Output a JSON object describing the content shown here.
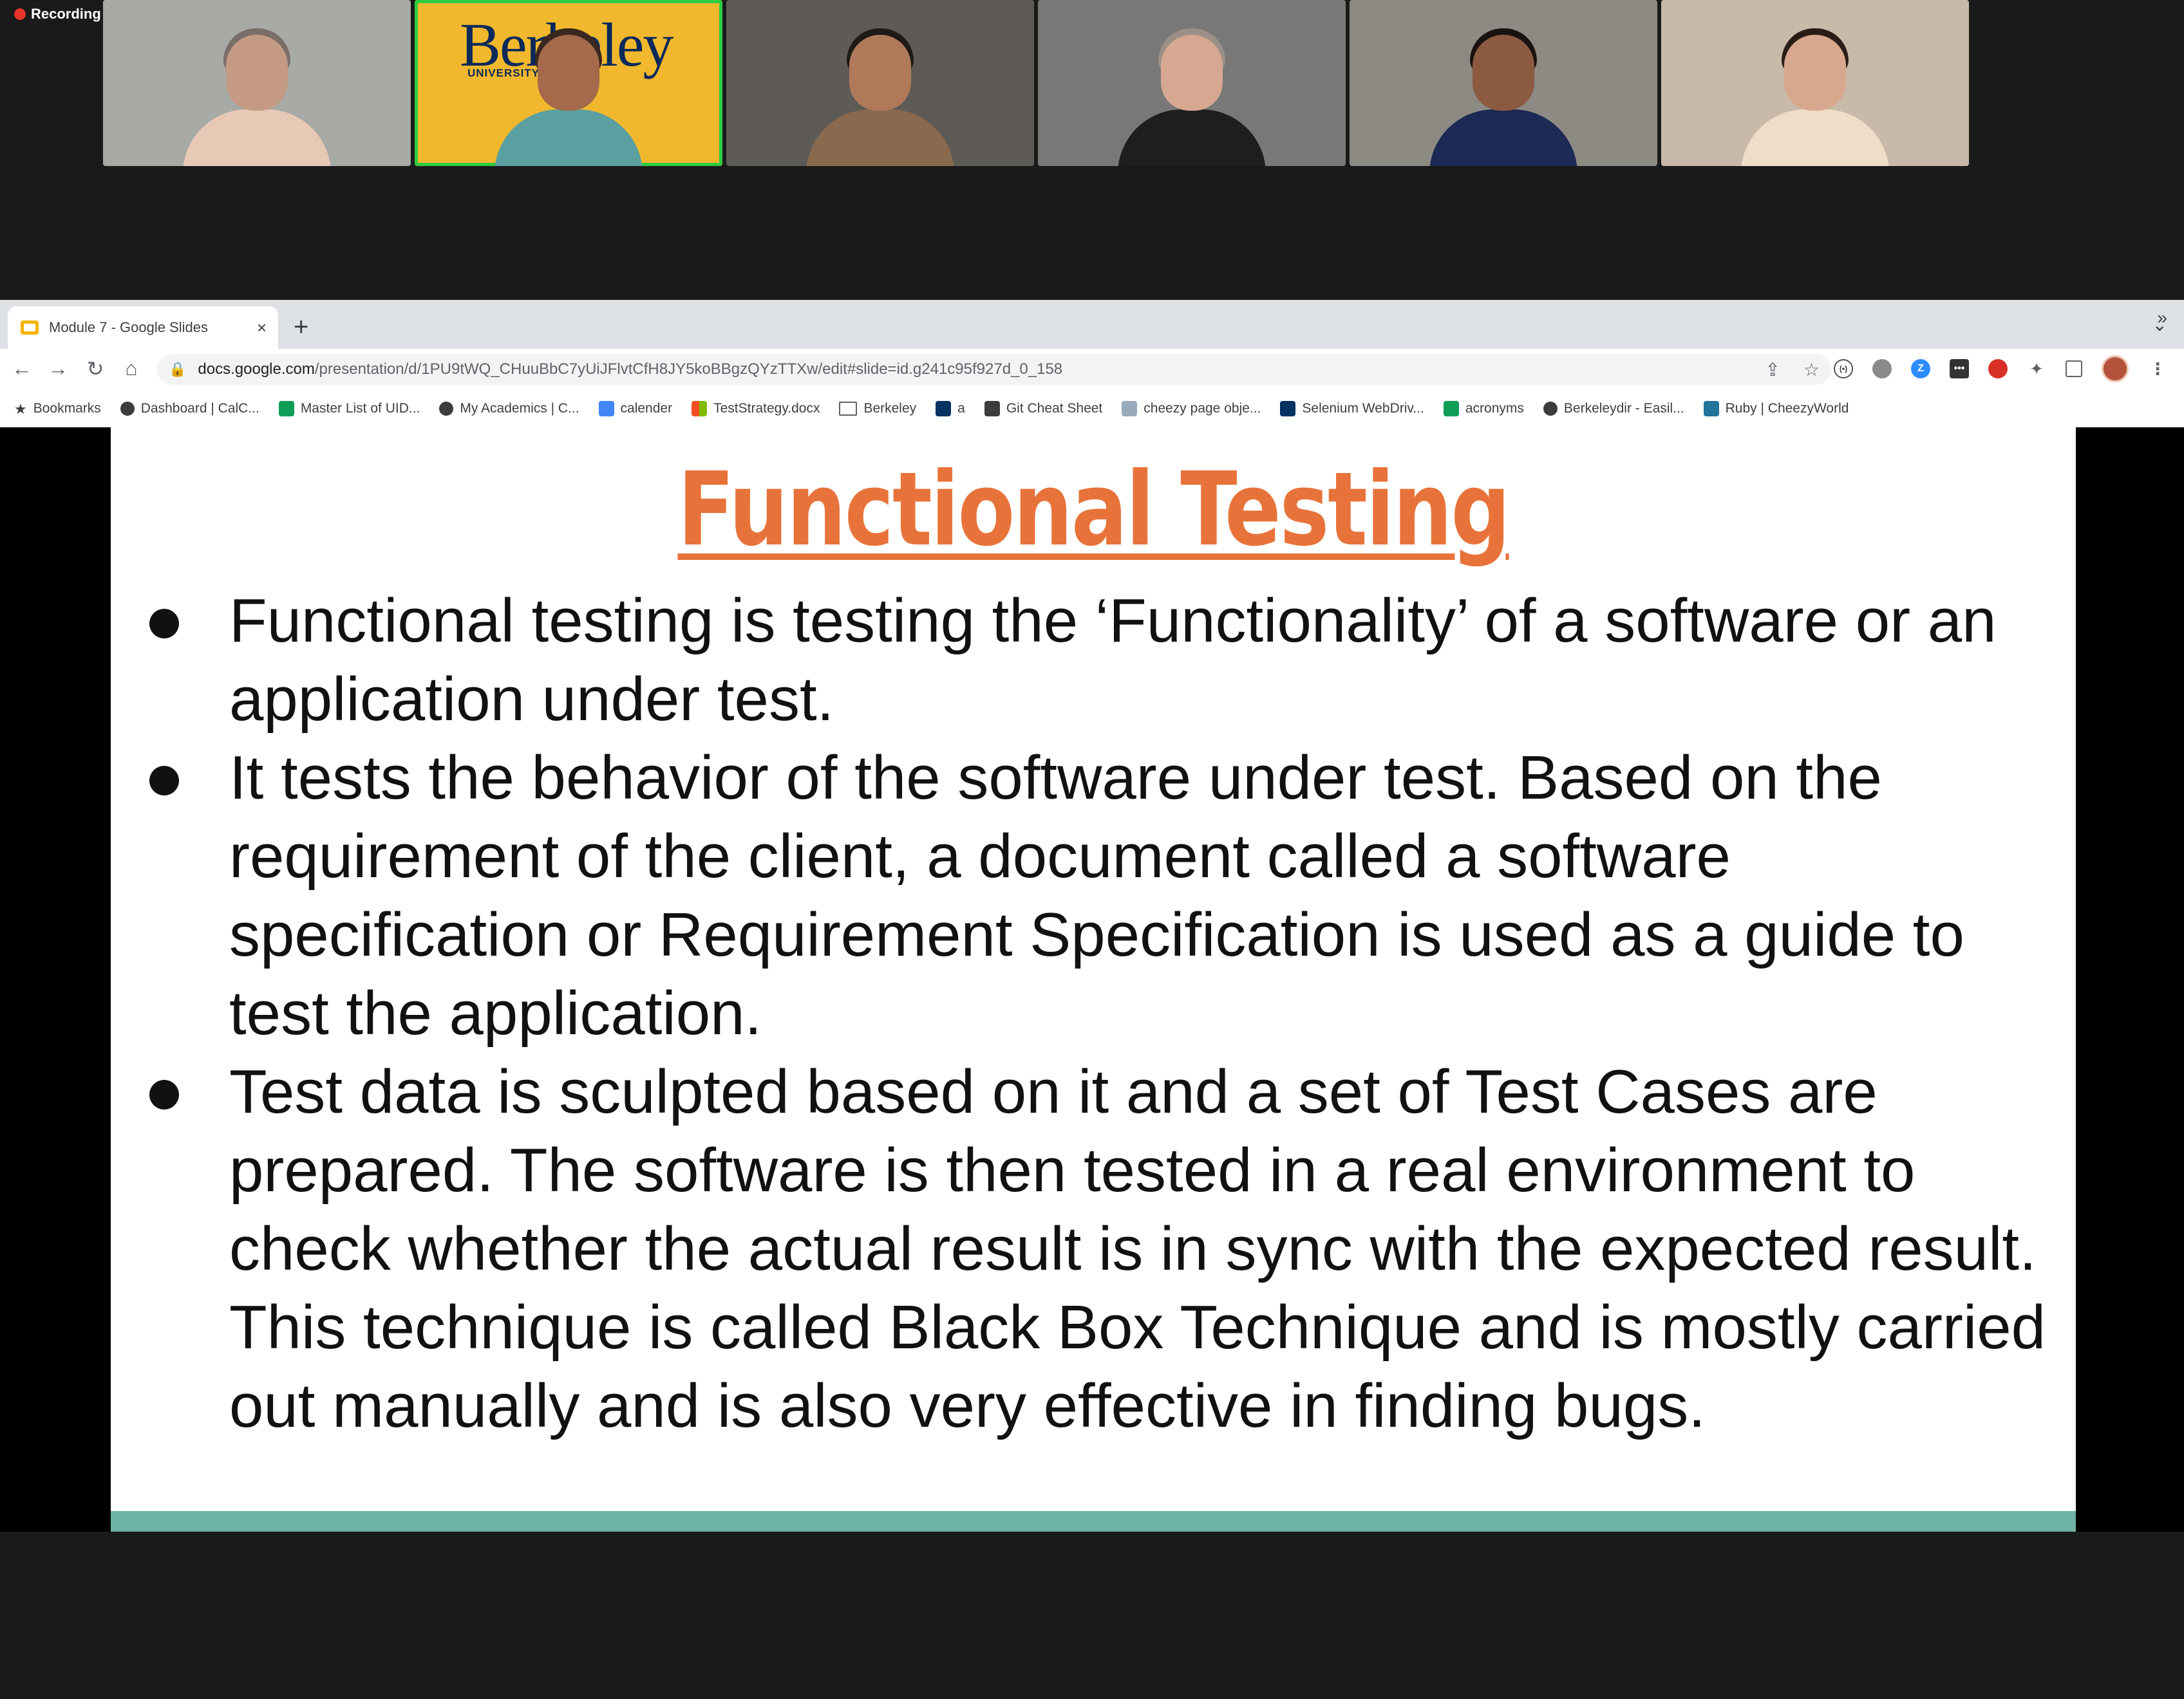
{
  "meeting": {
    "recording_label": "Recording",
    "participants": [
      {
        "bg": "#a7aaa5",
        "skin": "#c49a84",
        "hair": "#7a6e68",
        "shirt": "#e8c9b6"
      },
      {
        "bg": "#f1b82d",
        "skin": "#a5694c",
        "hair": "#3a2720",
        "shirt": "#5aa0a0",
        "logo_text": "Berkeley",
        "logo_sub": "UNIVERSITY OF"
      },
      {
        "bg": "#5e5a55",
        "skin": "#b07a5a",
        "hair": "#1e1a18",
        "shirt": "#8a6a4e"
      },
      {
        "bg": "#7a7876",
        "skin": "#d6a892",
        "hair": "#9a9088",
        "shirt": "#1e1e1e"
      },
      {
        "bg": "#8d8a84",
        "skin": "#8c5a40",
        "hair": "#1a1210",
        "shirt": "#1c2a55"
      },
      {
        "bg": "#c8b9a8",
        "skin": "#d8a88e",
        "hair": "#2a1c16",
        "shirt": "#f0ddc8"
      }
    ]
  },
  "browser": {
    "tab_title": "Module 7 - Google Slides",
    "tab_close": "×",
    "new_tab": "+",
    "tab_search": "⌄",
    "nav": {
      "back": "←",
      "forward": "→",
      "reload": "↻",
      "home": "⌂"
    },
    "url_host": "docs.google.com",
    "url_path": "/presentation/d/1PU9tWQ_CHuuBbC7yUiJFlvtCfH8JY5koBBgzQYzTTXw/edit#slide=id.g241c95f927d_0_158",
    "omnibox_share": "⇪",
    "omnibox_star": "☆",
    "bookmarks": [
      {
        "label": "Bookmarks",
        "icon": "star-icon",
        "color": "#3c4043"
      },
      {
        "label": "Dashboard | CalC...",
        "icon": "c-icon",
        "color": "#3c3c3c"
      },
      {
        "label": "Master List of UID...",
        "icon": "sheets-icon",
        "color": "#0f9d58"
      },
      {
        "label": "My Academics | C...",
        "icon": "c-icon",
        "color": "#3c3c3c"
      },
      {
        "label": "calender",
        "icon": "calendar-icon",
        "color": "#4285f4"
      },
      {
        "label": "TestStrategy.docx",
        "icon": "windows-icon",
        "color": "#f25022"
      },
      {
        "label": "Berkeley",
        "icon": "folder-icon",
        "color": "#5f6368"
      },
      {
        "label": "a",
        "icon": "cal-icon",
        "color": "#003262"
      },
      {
        "label": "Git Cheat Sheet",
        "icon": "git-icon",
        "color": "#3c3c3c"
      },
      {
        "label": "cheezy page obje...",
        "icon": "cheezy-icon",
        "color": "#9ab"
      },
      {
        "label": "Selenium WebDriv...",
        "icon": "cal-icon",
        "color": "#003262"
      },
      {
        "label": "acronyms",
        "icon": "sheets-icon",
        "color": "#0f9d58"
      },
      {
        "label": "Berkeleydir - Easil...",
        "icon": "globe-icon",
        "color": "#3c3c3c"
      },
      {
        "label": "Ruby | CheezyWorld",
        "icon": "wordpress-icon",
        "color": "#21759b"
      }
    ],
    "bookmarks_more": "»"
  },
  "slide": {
    "title": "Functional Testing",
    "bullets": [
      "Functional testing is testing the ‘Functionality’ of a software or an application under test.",
      "It tests the behavior of the software under test. Based on the requirement of the client, a document called a software specification or Requirement Specification is used as a guide to test the application.",
      "Test data is sculpted based on it and a set of Test Cases are prepared. The software is then tested in a real environment to check whether the actual result is in sync with the expected result. This technique is called Black Box Technique and is mostly carried out manually and is also very effective in finding bugs."
    ],
    "title_color": "#e8733a",
    "footer_bar_color": "#6fb2a6"
  }
}
